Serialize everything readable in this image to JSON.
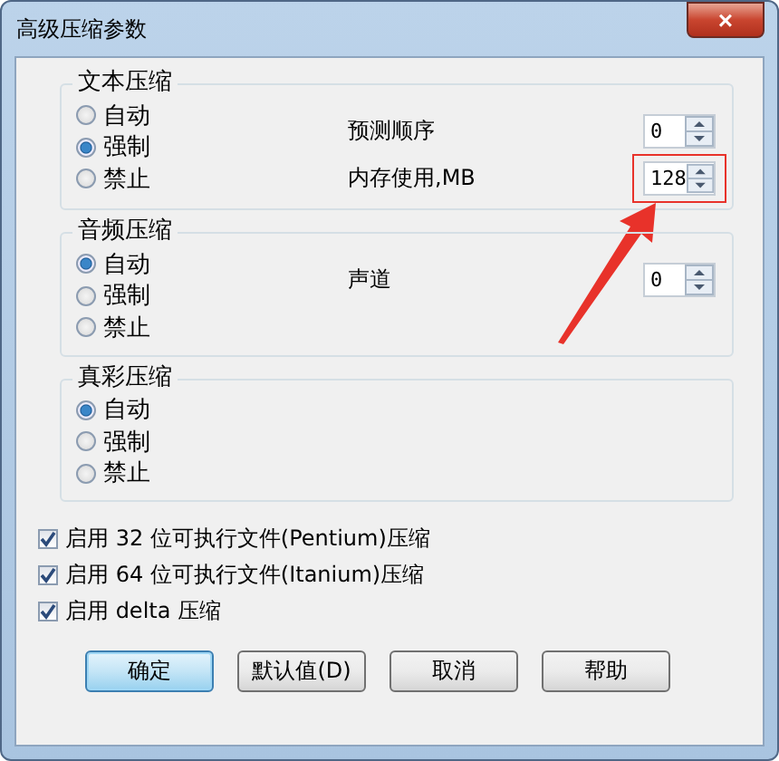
{
  "window": {
    "title": "高级压缩参数",
    "close": "×"
  },
  "groups": [
    {
      "title": "文本压缩",
      "options": [
        {
          "label": "自动",
          "selected": false
        },
        {
          "label": "强制",
          "selected": true
        },
        {
          "label": "禁止",
          "selected": false
        }
      ],
      "fields": [
        {
          "label": "预测顺序",
          "value": "0",
          "highlighted": false
        },
        {
          "label": "内存使用,MB",
          "value": "128",
          "highlighted": true
        }
      ]
    },
    {
      "title": "音频压缩",
      "options": [
        {
          "label": "自动",
          "selected": true
        },
        {
          "label": "强制",
          "selected": false
        },
        {
          "label": "禁止",
          "selected": false
        }
      ],
      "fields": [
        {
          "label": "声道",
          "value": "0",
          "highlighted": false
        }
      ]
    },
    {
      "title": "真彩压缩",
      "options": [
        {
          "label": "自动",
          "selected": true
        },
        {
          "label": "强制",
          "selected": false
        },
        {
          "label": "禁止",
          "selected": false
        }
      ]
    }
  ],
  "checkboxes": [
    {
      "label": "启用 32 位可执行文件(Pentium)压缩",
      "checked": true
    },
    {
      "label": "启用 64 位可执行文件(Itanium)压缩",
      "checked": true
    },
    {
      "label": "启用 delta 压缩",
      "checked": true
    }
  ],
  "buttons": [
    {
      "label": "确定",
      "default": true
    },
    {
      "label": "默认值(D)",
      "default": false
    },
    {
      "label": "取消",
      "default": false
    },
    {
      "label": "帮助",
      "default": false
    }
  ]
}
